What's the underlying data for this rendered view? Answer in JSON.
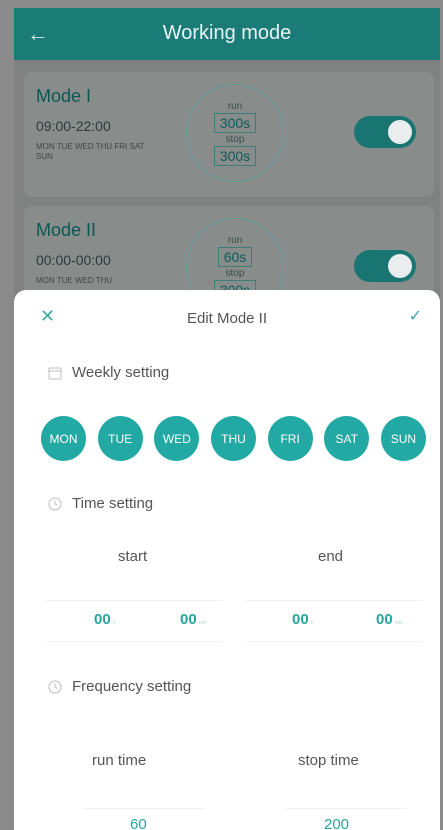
{
  "header": {
    "title": "Working mode"
  },
  "modes": [
    {
      "name": "Mode I",
      "time": "09:00-22:00",
      "days": "MON TUE WED THU FRI SAT SUN",
      "run_label": "run",
      "run_value": "300s",
      "stop_label": "stop",
      "stop_value": "300s",
      "enabled": true
    },
    {
      "name": "Mode II",
      "time": "00:00-00:00",
      "days": "MON TUE WED THU",
      "run_label": "run",
      "run_value": "60s",
      "stop_label": "stop",
      "stop_value": "300s",
      "enabled": true
    }
  ],
  "sheet": {
    "title": "Edit Mode II",
    "weekly_label": "Weekly setting",
    "days": [
      "MON",
      "TUE",
      "WED",
      "THU",
      "FRI",
      "SAT",
      "SUN"
    ],
    "time_label": "Time setting",
    "start_label": "start",
    "end_label": "end",
    "start_hour": "00",
    "start_min": "00",
    "end_hour": "00",
    "end_min": "00",
    "hour_unit": "h",
    "min_unit": "min",
    "frequency_label": "Frequency setting",
    "run_time_label": "run time",
    "stop_time_label": "stop time",
    "run_time_value": "60",
    "stop_time_value": "200"
  },
  "colors": {
    "header": "#1a7b77",
    "accent": "#23a9a3"
  }
}
